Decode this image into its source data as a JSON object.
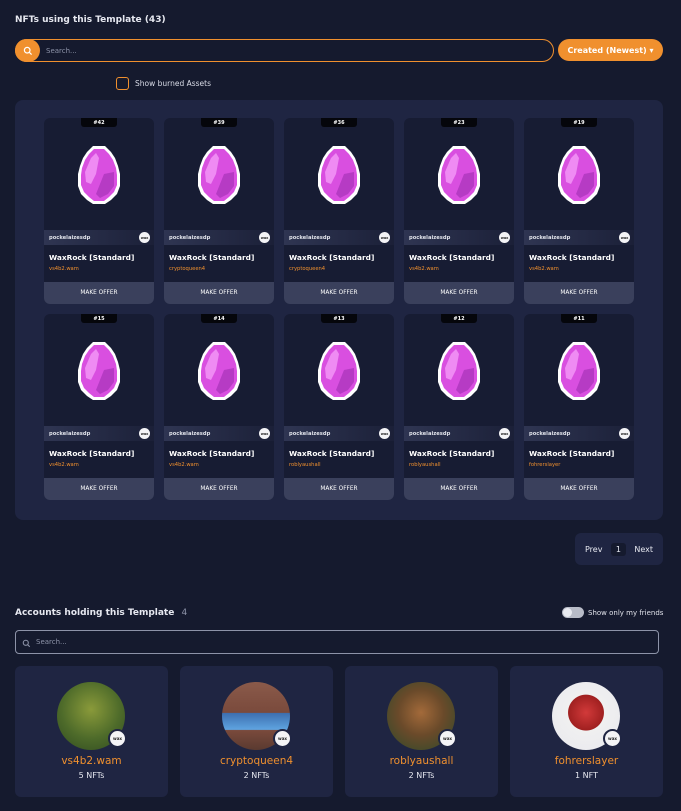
{
  "nft_section": {
    "title": "NFTs using this Template",
    "count": "(43)",
    "search_placeholder": "Search...",
    "sort_label": "Created (Newest) ▾",
    "burned_label": "Show burned Assets"
  },
  "cards": [
    {
      "mint": "#42",
      "collection": "pockelaizesdp",
      "name": "WaxRock [Standard]",
      "owner": "vs4b2.wam",
      "offer": "MAKE OFFER"
    },
    {
      "mint": "#39",
      "collection": "pockelaizesdp",
      "name": "WaxRock [Standard]",
      "owner": "cryptoqueen4",
      "offer": "MAKE OFFER"
    },
    {
      "mint": "#36",
      "collection": "pockelaizesdp",
      "name": "WaxRock [Standard]",
      "owner": "cryptoqueen4",
      "offer": "MAKE OFFER"
    },
    {
      "mint": "#23",
      "collection": "pockelaizesdp",
      "name": "WaxRock [Standard]",
      "owner": "vs4b2.wam",
      "offer": "MAKE OFFER"
    },
    {
      "mint": "#19",
      "collection": "pockelaizesdp",
      "name": "WaxRock [Standard]",
      "owner": "vs4b2.wam",
      "offer": "MAKE OFFER"
    },
    {
      "mint": "#15",
      "collection": "pockelaizesdp",
      "name": "WaxRock [Standard]",
      "owner": "vs4b2.wam",
      "offer": "MAKE OFFER"
    },
    {
      "mint": "#14",
      "collection": "pockelaizesdp",
      "name": "WaxRock [Standard]",
      "owner": "vs4b2.wam",
      "offer": "MAKE OFFER"
    },
    {
      "mint": "#13",
      "collection": "pockelaizesdp",
      "name": "WaxRock [Standard]",
      "owner": "roblyaushall",
      "offer": "MAKE OFFER"
    },
    {
      "mint": "#12",
      "collection": "pockelaizesdp",
      "name": "WaxRock [Standard]",
      "owner": "roblyaushall",
      "offer": "MAKE OFFER"
    },
    {
      "mint": "#11",
      "collection": "pockelaizesdp",
      "name": "WaxRock [Standard]",
      "owner": "fohrerslayer",
      "offer": "MAKE OFFER"
    }
  ],
  "pagination": {
    "prev": "Prev",
    "page": "1",
    "next": "Next"
  },
  "accounts_section": {
    "title": "Accounts holding this Template",
    "count": "4",
    "friends_label": "Show only my friends",
    "search_placeholder": "Search..."
  },
  "accounts": [
    {
      "name": "vs4b2.wam",
      "count": "5 NFTs"
    },
    {
      "name": "cryptoqueen4",
      "count": "2 NFTs"
    },
    {
      "name": "roblyaushall",
      "count": "2 NFTs"
    },
    {
      "name": "fohrerslayer",
      "count": "1 NFT"
    }
  ],
  "badge_text": "wax",
  "colors": {
    "accent": "#f0902e",
    "background": "#151a2e",
    "panel": "#1f2542",
    "gem": "#d94fe0"
  }
}
